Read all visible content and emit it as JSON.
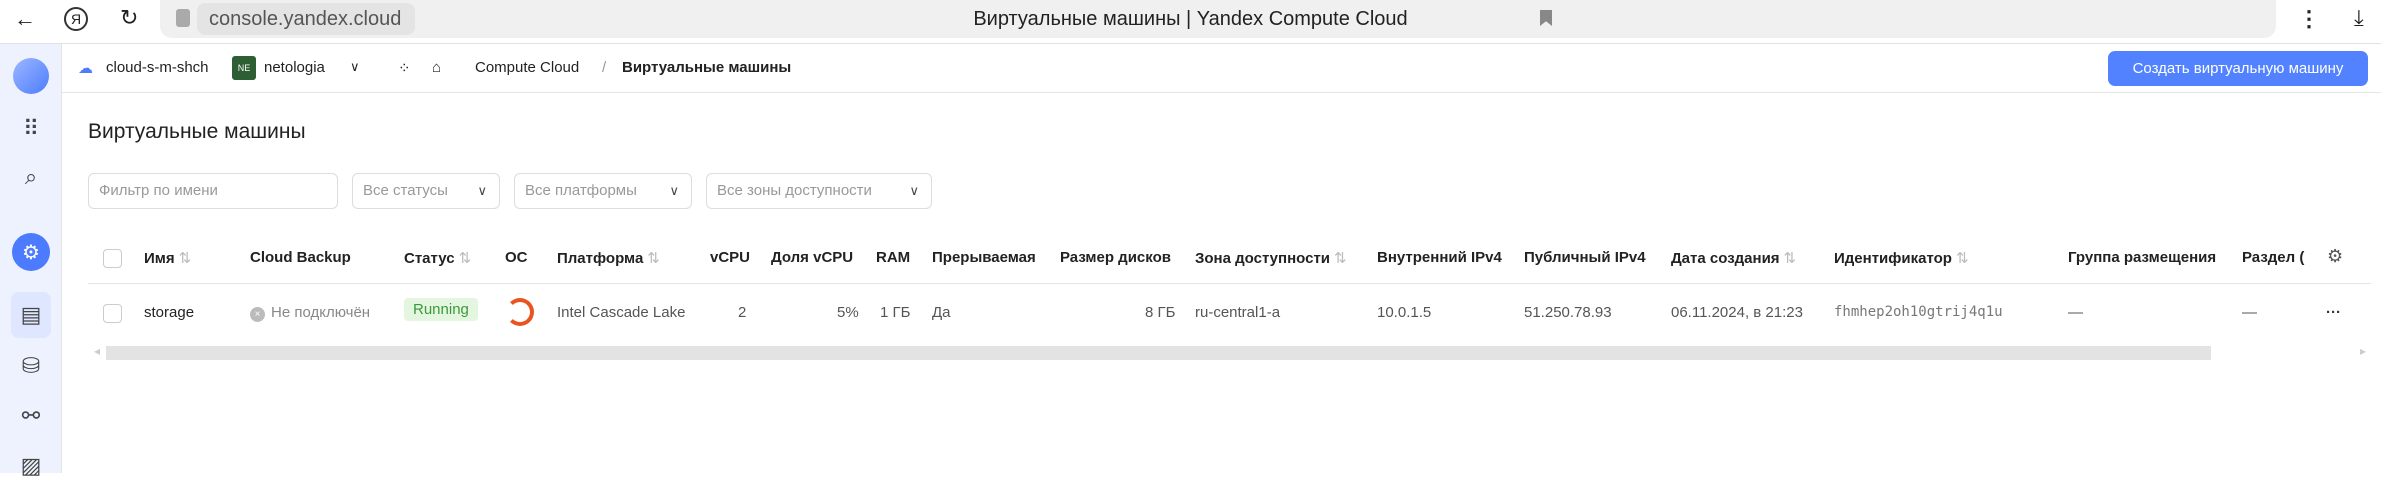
{
  "browser": {
    "url": "console.yandex.cloud",
    "window_title": "Виртуальные машины | Yandex Compute Cloud"
  },
  "header": {
    "cloud": "cloud-s-m-shch",
    "folder_badge": "NE",
    "folder": "netologia",
    "breadcrumb_service": "Compute Cloud",
    "breadcrumb_sep": "/",
    "breadcrumb_current": "Виртуальные машины",
    "create_button": "Создать виртуальную машину"
  },
  "page": {
    "title": "Виртуальные машины"
  },
  "filters": {
    "name_placeholder": "Фильтр по имени",
    "status": "Все статусы",
    "platform": "Все платформы",
    "zone": "Все зоны доступности"
  },
  "table": {
    "columns": [
      "Имя",
      "Cloud Backup",
      "Статус",
      "ОС",
      "Платформа",
      "vCPU",
      "Доля vCPU",
      "RAM",
      "Прерываемая",
      "Размер дисков",
      "Зона доступности",
      "Внутренний IPv4",
      "Публичный IPv4",
      "Дата создания",
      "Идентификатор",
      "Группа размещения",
      "Раздел ("
    ],
    "rows": [
      {
        "name": "storage",
        "backup": "Не подключён",
        "status": "Running",
        "os": "ubuntu",
        "platform": "Intel Cascade Lake",
        "vcpu": "2",
        "vcpu_share": "5%",
        "ram": "1 ГБ",
        "preemptible": "Да",
        "disk": "8 ГБ",
        "zone": "ru-central1-a",
        "internal_ip": "10.0.1.5",
        "public_ip": "51.250.78.93",
        "created": "06.11.2024, в 21:23",
        "id": "fhmhep2oh10gtrij4q1u",
        "placement_group": "—",
        "partition": "—"
      }
    ]
  },
  "colors": {
    "accent": "#5282ff",
    "running_bg": "#e4f5e0",
    "ubuntu": "#e95420"
  }
}
